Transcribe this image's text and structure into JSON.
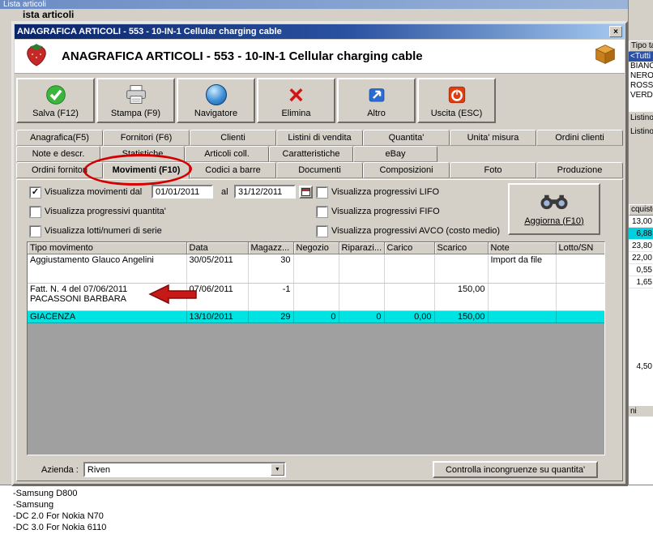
{
  "icons": {
    "close": "×",
    "check": "✓",
    "dropdown": "▼",
    "delete_x": "×"
  },
  "background": {
    "taskbar_title": "Lista articoli",
    "window_caption": "ista articoli",
    "bottom_items": [
      "-Samsung D800",
      "-Samsung",
      "-DC 2.0 For Nokia N70",
      "-DC 3.0 For Nokia 6110"
    ],
    "right_strip": {
      "col_header": "Tipo ta",
      "filter_items": [
        "<Tutti",
        "BIANC",
        "NERO",
        "ROSS",
        "VERD"
      ],
      "labels": [
        "Listino",
        "Listino"
      ],
      "price_header": "cquisto",
      "prices": [
        "13,00",
        "6,88",
        "23,80",
        "22,00",
        "0,55",
        "1,65"
      ],
      "price_extra": "4,50",
      "partial_label": "ni"
    }
  },
  "dialog": {
    "titlebar": {
      "title": "ANAGRAFICA ARTICOLI - 553 - 10-IN-1 Cellular charging cable"
    },
    "header": {
      "title": "ANAGRAFICA ARTICOLI - 553 - 10-IN-1 Cellular charging cable"
    },
    "toolbar": {
      "buttons": [
        {
          "label": "Salva (F12)"
        },
        {
          "label": "Stampa (F9)"
        },
        {
          "label": "Navigatore"
        },
        {
          "label": "Elimina"
        },
        {
          "label": "Altro"
        },
        {
          "label": "Uscita (ESC)"
        }
      ]
    },
    "tabs": {
      "row1": [
        "Anagrafica(F5)",
        "Fornitori (F6)",
        "Clienti",
        "Listini di vendita",
        "Quantita'",
        "Unita' misura",
        "Ordini clienti"
      ],
      "row2": [
        "Note e descr.",
        "Statistiche",
        "Articoli coll.",
        "Caratteristiche",
        "eBay"
      ],
      "row3": [
        "Ordini fornitori",
        "Movimenti (F10)",
        "Codici a barre",
        "Documenti",
        "Composizioni",
        "Foto",
        "Produzione"
      ]
    },
    "filters": {
      "movimenti_dal": {
        "label": "Visualizza movimenti dal",
        "checked": true,
        "from": "01/01/2011",
        "al_label": "al",
        "to": "31/12/2011"
      },
      "progressivi_quantita": {
        "label": "Visualizza progressivi quantita'",
        "checked": false
      },
      "lotti": {
        "label": "Visualizza lotti/numeri di serie",
        "checked": false
      },
      "lifo": {
        "label": "Visualizza progressivi LIFO",
        "checked": false
      },
      "fifo": {
        "label": "Visualizza progressivi FIFO",
        "checked": false
      },
      "avco": {
        "label": "Visualizza progressivi AVCO (costo medio)",
        "checked": false
      },
      "aggiorna_label": "Aggiorna (F10)"
    },
    "grid": {
      "columns": [
        "Tipo movimento",
        "Data",
        "Magazz...",
        "Negozio",
        "Riparazi...",
        "Carico",
        "Scarico",
        "Note",
        "Lotto/SN"
      ],
      "rows": [
        {
          "tipo": "Aggiustamento Glauco Angelini",
          "data": "30/05/2011",
          "magazz": "30",
          "negozio": "",
          "riparazi": "",
          "carico": "",
          "scarico": "",
          "note": "Import da file",
          "lotto": ""
        },
        {
          "tipo1": "Fatt. N. 4 del 07/06/2011",
          "tipo2": "PACASSONI BARBARA",
          "data": "07/06/2011",
          "magazz": "-1",
          "negozio": "",
          "riparazi": "",
          "carico": "",
          "scarico": "150,00",
          "note": "",
          "lotto": ""
        },
        {
          "tipo": "GIACENZA",
          "data": "13/10/2011",
          "magazz": "29",
          "negozio": "0",
          "riparazi": "0",
          "carico": "0,00",
          "scarico": "150,00",
          "note": "",
          "lotto": ""
        }
      ]
    },
    "footer": {
      "azienda_label": "Azienda :",
      "azienda_value": "Riven",
      "check_button": "Controlla incongruenze su quantita'"
    }
  }
}
